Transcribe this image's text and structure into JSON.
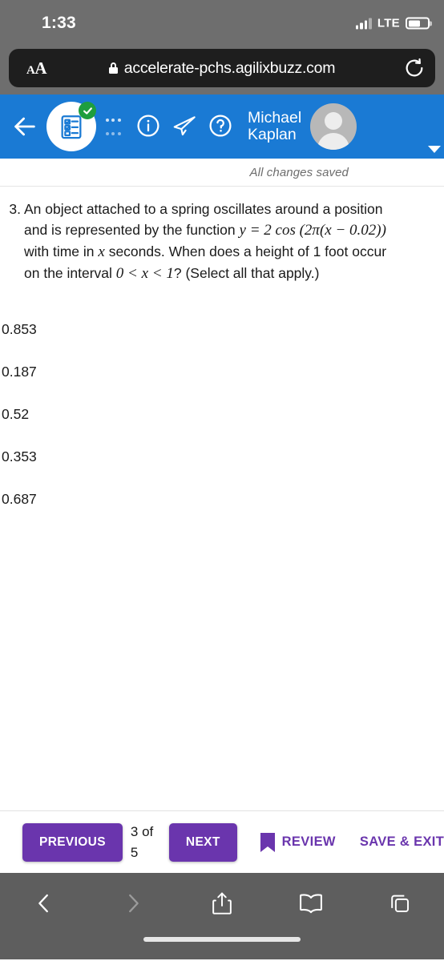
{
  "status_bar": {
    "time": "1:33",
    "network_label": "LTE",
    "signal_icon": "cellular-signal-icon",
    "battery_icon": "battery-icon",
    "battery_level_pct": 62
  },
  "browser": {
    "text_size_label_small": "A",
    "text_size_label_large": "A",
    "text_size_icon": "text-size-icon",
    "lock_icon": "lock-icon",
    "url": "accelerate-pchs.agilixbuzz.com",
    "reload_icon": "reload-icon",
    "toolbar": [
      {
        "name": "back-icon",
        "glyph": "chevron-left"
      },
      {
        "name": "forward-icon",
        "glyph": "chevron-right"
      },
      {
        "name": "share-icon",
        "glyph": "share"
      },
      {
        "name": "bookmarks-icon",
        "glyph": "book"
      },
      {
        "name": "tabs-icon",
        "glyph": "tabs"
      }
    ]
  },
  "app_header": {
    "background_color": "#1a7ad4",
    "back_icon": "back-arrow-icon",
    "activity_icon": "checklist-clipboard-icon",
    "completed_badge_icon": "green-check-badge-icon",
    "completed_badge_color": "#1e9e3e",
    "overflow_icon": "more-options-icon",
    "info_icon": "info-circle-icon",
    "send_icon": "paper-plane-icon",
    "help_icon": "question-circle-icon",
    "user_name_line1": "Michael",
    "user_name_line2": "Kaplan",
    "avatar_icon": "user-avatar",
    "avatar_caret_icon": "chevron-down-icon"
  },
  "save_status": "All changes saved",
  "question": {
    "number": "3.",
    "line1": "An object attached to a spring oscillates around a position",
    "line2_pre": "and is represented by the function ",
    "line2_math": "y = 2 cos (2π(x − 0.02))",
    "line3_pre": "with time in ",
    "line3_math": "x",
    "line3_post": " seconds. When does a height of 1 foot occur",
    "line4_pre": "on the interval ",
    "line4_math": "0 < x < 1",
    "line4_post": "? (Select all that apply.)"
  },
  "options": [
    {
      "label": "0.853"
    },
    {
      "label": "0.187"
    },
    {
      "label": "0.52"
    },
    {
      "label": "0.353"
    },
    {
      "label": "0.687"
    }
  ],
  "action_bar": {
    "previous_label": "PREVIOUS",
    "page_counter_line1": "3 of",
    "page_counter_line2": "5",
    "next_label": "NEXT",
    "bookmark_icon": "bookmark-icon",
    "review_label": "REVIEW",
    "save_exit_label": "SAVE & EXIT",
    "accent_color": "#6a35ad"
  }
}
